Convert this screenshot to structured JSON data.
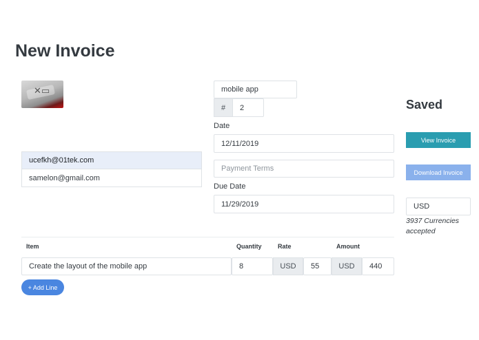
{
  "page": {
    "title": "New Invoice"
  },
  "invoice": {
    "name": "mobile app",
    "number_prefix": "#",
    "number": "2",
    "date_label": "Date",
    "date": "12/11/2019",
    "payment_terms_placeholder": "Payment Terms",
    "due_date_label": "Due Date",
    "due_date": "11/29/2019"
  },
  "emails": [
    {
      "address": "ucefkh@01tek.com",
      "selected": true
    },
    {
      "address": "samelon@gmail.com",
      "selected": false
    }
  ],
  "sidebar": {
    "status": "Saved",
    "view_button": "View Invoice",
    "download_button": "Download Invoice",
    "currency": "USD",
    "currency_note": "3937 Currencies accepted"
  },
  "table": {
    "headers": {
      "item": "Item",
      "quantity": "Quantity",
      "rate": "Rate",
      "amount": "Amount"
    },
    "rows": [
      {
        "item": "Create the layout of the mobile app",
        "quantity": "8",
        "rate_currency": "USD",
        "rate": "55",
        "amount_currency": "USD",
        "amount": "440"
      }
    ]
  },
  "actions": {
    "add_line": "+ Add Line"
  },
  "colors": {
    "primary": "#2a9db0",
    "download": "#8ab1ec",
    "add_line": "#4a86e0",
    "selected_row": "#e8eef9"
  }
}
